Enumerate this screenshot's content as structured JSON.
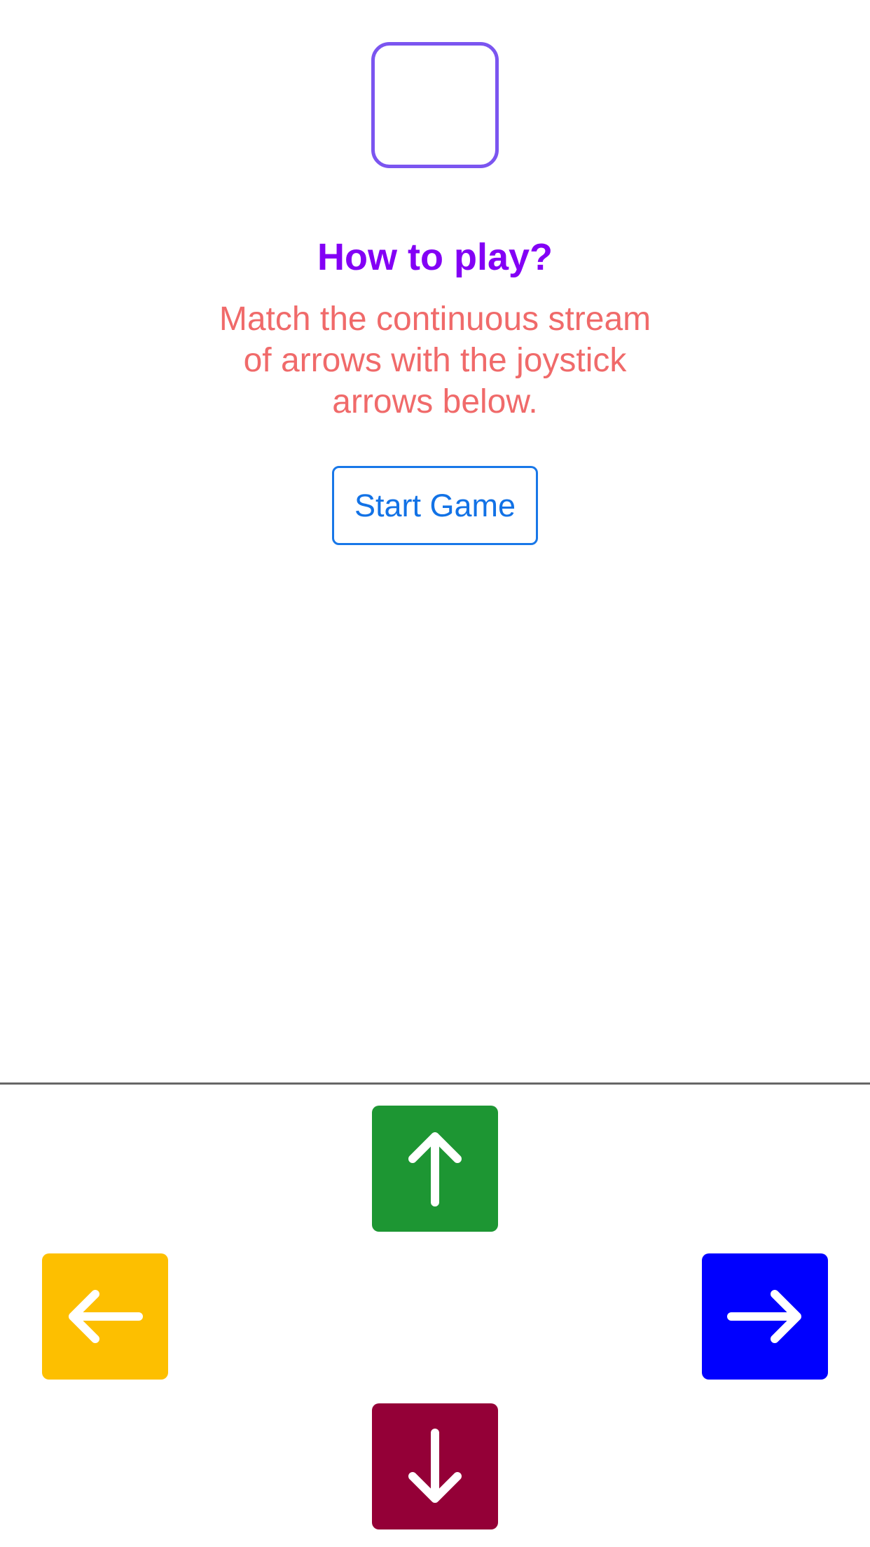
{
  "game": {
    "target_label": ""
  },
  "instructions": {
    "title": "How to play?",
    "body": "Match the continuous stream of arrows with the joystick arrows below."
  },
  "start_button": {
    "label": "Start Game"
  },
  "joystick": {
    "up": {
      "icon": "arrow-up-icon",
      "color": "#1d9633"
    },
    "left": {
      "icon": "arrow-left-icon",
      "color": "#fdbf00"
    },
    "right": {
      "icon": "arrow-right-icon",
      "color": "#0000ff"
    },
    "down": {
      "icon": "arrow-down-icon",
      "color": "#940037"
    }
  },
  "colors": {
    "target_border": "#7b55f0",
    "title": "#8300f5",
    "body_text": "#f06a6a",
    "button_accent": "#1877e8",
    "divider": "#666666"
  }
}
